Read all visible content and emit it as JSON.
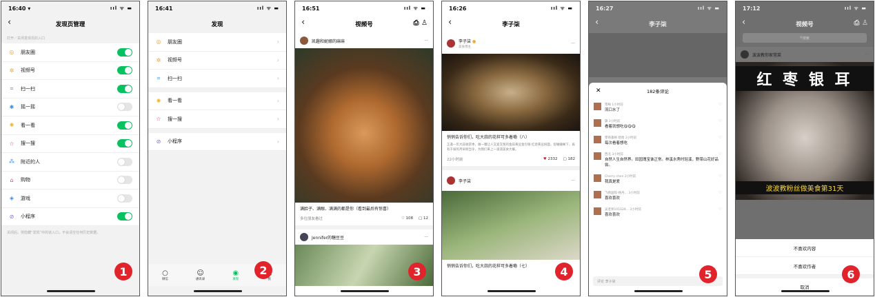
{
  "badges": [
    "1",
    "2",
    "3",
    "4",
    "5",
    "6"
  ],
  "p1": {
    "time": "16:40 ▾",
    "signal": "ııl ᯤ ▬",
    "title": "发现页管理",
    "hint": "打开／关闭发现页的入口",
    "items": [
      {
        "icon": "◎",
        "color": "#e5a03a",
        "label": "朋友圈",
        "on": true
      },
      {
        "icon": "✲",
        "color": "#e5a03a",
        "label": "视频号",
        "on": true
      },
      {
        "icon": "⌗",
        "color": "#3c8be0",
        "label": "扫一扫",
        "on": true
      },
      {
        "icon": "✱",
        "color": "#3c8be0",
        "label": "摇一摇",
        "on": false
      },
      {
        "icon": "✺",
        "color": "#f2b62b",
        "label": "看一看",
        "on": true
      },
      {
        "icon": "☆",
        "color": "#e0436c",
        "label": "搜一搜",
        "on": true
      },
      {
        "icon": "⁂",
        "color": "#3c8be0",
        "label": "附近的人",
        "on": false
      },
      {
        "icon": "⌂",
        "color": "#e0436c",
        "label": "购物",
        "on": false
      },
      {
        "icon": "◈",
        "color": "#3c8be0",
        "label": "游戏",
        "on": false
      },
      {
        "icon": "⊘",
        "color": "#7b6cd9",
        "label": "小程序",
        "on": true
      }
    ],
    "note": "关闭后，将隐藏“发现”中的该入口，不会清空任何历史数据。"
  },
  "p2": {
    "time": "16:41",
    "signal": "ııl ᯤ ▬",
    "title": "发现",
    "items": [
      {
        "icon": "◎",
        "color": "#e5a03a",
        "label": "朋友圈"
      },
      {
        "icon": "✲",
        "color": "#e5a03a",
        "label": "视频号"
      },
      {
        "icon": "⌗",
        "color": "#3c8be0",
        "label": "扫一扫"
      },
      {
        "icon": "✺",
        "color": "#f2b62b",
        "label": "看一看"
      },
      {
        "icon": "☆",
        "color": "#e0436c",
        "label": "搜一搜"
      },
      {
        "icon": "⊘",
        "color": "#7b6cd9",
        "label": "小程序"
      }
    ],
    "tabs": [
      {
        "icon": "○",
        "label": "微信"
      },
      {
        "icon": "☺",
        "label": "通讯录"
      },
      {
        "icon": "◉",
        "label": "发现",
        "active": true
      },
      {
        "icon": "♙",
        "label": "我"
      }
    ]
  },
  "p3": {
    "time": "16:51",
    "signal": "ııl ᯤ ▬",
    "title": "视频号",
    "author": "凯趣和妮娜的麻麻",
    "caption": "满脸子、满眼、满满的都是你（看到最后有惊喜）",
    "friends": "多位朋友看过",
    "likes": "108",
    "comments": "12",
    "author2": "Jennifer的糖豆豆"
  },
  "p4": {
    "time": "16:26",
    "signal": "ııl ᯤ ▬",
    "title": "李子柒",
    "author": "李子柒",
    "sub": "美食博主",
    "caption": "悄悄告诉你们，吃大蒜的花样可多着嘞（八）",
    "desc": "正逢一年大蒜收获季，做一罐让人又爱又恨的金蒜黄豆金包银·红烧黄豆焖面，捉蛐蛐阁下，再有于坡的月早刚当令，为我们来上一道道美食大餐。",
    "ago": "22小时前",
    "likes": "2332",
    "comments": "182",
    "author2": "李子柒",
    "caption2": "悄悄告诉你们，吃大蒜的花样可多着嘞（七）"
  },
  "p5": {
    "time": "16:27",
    "signal": "ııl ᯤ ▬",
    "title": "李子柒",
    "count": "182条评论",
    "comments": [
      {
        "name": "雪梅 1小时前",
        "text": "流口水了"
      },
      {
        "name": "飘 2小时前",
        "text": "看着就想吃😋😋😋"
      },
      {
        "name": "零哥蓬格 哈哈 2小时前",
        "text": "每次看着想吃"
      },
      {
        "name": "西北 3小时前",
        "text": "自然人生自然界。田园瑰宝谁正常。林溪水秀时轻溪，野菜山花好品尝。"
      },
      {
        "name": "Cherry chen 2小时前",
        "text": "我真是爱"
      },
      {
        "name": "飞扬国际-杨丹... 3小时前",
        "text": "喜欢喜欢"
      },
      {
        "name": "吴老师101028... 3小时前",
        "text": "喜欢喜欢"
      }
    ],
    "input": "评论 李子柒"
  },
  "p6": {
    "time": "17:12",
    "signal": "ııl ᯤ ▬",
    "title": "视频号",
    "search": "搜索",
    "author": "波波教你家常菜",
    "banner": "红 枣 银 耳",
    "subbanner": "波波教粉丝做美食第31天",
    "options": [
      "不喜欢内容",
      "不喜欢作者",
      "取消"
    ]
  }
}
